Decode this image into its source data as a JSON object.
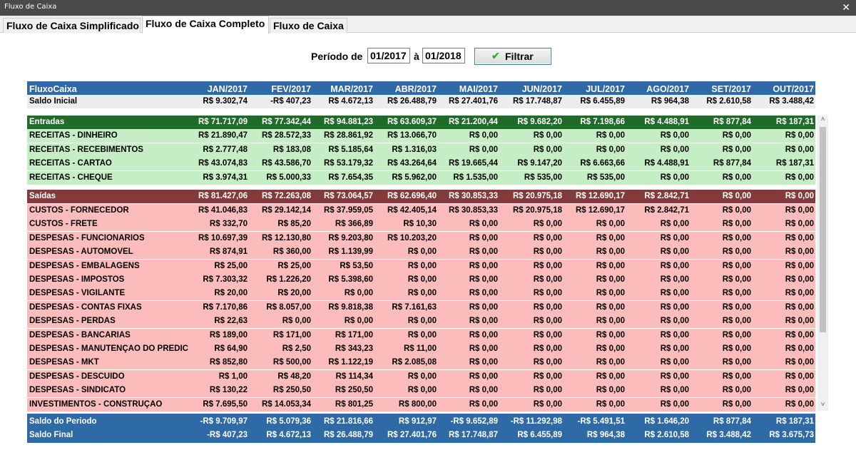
{
  "window": {
    "title": "Fluxo de Caixa",
    "close_glyph": "✕"
  },
  "tabs": [
    {
      "label": "Fluxo de Caixa Simplificado"
    },
    {
      "label": "Fluxo de Caixa Completo"
    },
    {
      "label": "Fluxo de Caixa"
    }
  ],
  "filter": {
    "periodo_label": "Período de",
    "date_from": "01/2017",
    "between_label": "à",
    "date_to": "01/2018",
    "button_label": "Filtrar",
    "button_icon": "check-icon"
  },
  "grid": {
    "header": [
      "FluxoCaixa",
      "JAN/2017",
      "FEV/2017",
      "MAR/2017",
      "ABR/2017",
      "MAI/2017",
      "JUN/2017",
      "JUL/2017",
      "AGO/2017",
      "SET/2017",
      "OUT/2017"
    ],
    "saldo_inicial": [
      "Saldo Inicial",
      "R$ 9.302,74",
      "-R$ 407,23",
      "R$ 4.672,13",
      "R$ 26.488,79",
      "R$ 27.401,76",
      "R$ 17.748,87",
      "R$ 6.455,89",
      "R$ 964,38",
      "R$ 2.610,58",
      "R$ 3.488,42"
    ],
    "entradas": [
      "Entradas",
      "R$ 71.717,09",
      "R$ 77.342,44",
      "R$ 94.881,23",
      "R$ 63.609,37",
      "R$ 21.200,44",
      "R$ 9.682,20",
      "R$ 7.198,66",
      "R$ 4.488,91",
      "R$ 877,84",
      "R$ 187,31"
    ],
    "entradas_rows": [
      [
        "RECEITAS - DINHEIRO",
        "R$ 21.890,47",
        "R$ 28.572,33",
        "R$ 28.861,92",
        "R$ 13.066,70",
        "R$ 0,00",
        "R$ 0,00",
        "R$ 0,00",
        "R$ 0,00",
        "R$ 0,00",
        "R$ 0,00"
      ],
      [
        "RECEITAS - RECEBIMENTOS",
        "R$ 2.777,48",
        "R$ 183,08",
        "R$ 5.185,64",
        "R$ 1.316,03",
        "R$ 0,00",
        "R$ 0,00",
        "R$ 0,00",
        "R$ 0,00",
        "R$ 0,00",
        "R$ 0,00"
      ],
      [
        "RECEITAS - CARTAO",
        "R$ 43.074,83",
        "R$ 43.586,70",
        "R$ 53.179,32",
        "R$ 43.264,64",
        "R$ 19.665,44",
        "R$ 9.147,20",
        "R$ 6.663,66",
        "R$ 4.488,91",
        "R$ 877,84",
        "R$ 187,31"
      ],
      [
        "RECEITAS - CHEQUE",
        "R$ 3.974,31",
        "R$ 5.000,33",
        "R$ 7.654,35",
        "R$ 5.962,00",
        "R$ 1.535,00",
        "R$ 535,00",
        "R$ 535,00",
        "R$ 0,00",
        "R$ 0,00",
        "R$ 0,00"
      ]
    ],
    "saidas": [
      "Saídas",
      "R$ 81.427,06",
      "R$ 72.263,08",
      "R$ 73.064,57",
      "R$ 62.696,40",
      "R$ 30.853,33",
      "R$ 20.975,18",
      "R$ 12.690,17",
      "R$ 2.842,71",
      "R$ 0,00",
      "R$ 0,00"
    ],
    "saidas_rows": [
      [
        "CUSTOS - FORNECEDOR",
        "R$ 41.046,83",
        "R$ 29.142,14",
        "R$ 37.959,05",
        "R$ 42.405,14",
        "R$ 30.853,33",
        "R$ 20.975,18",
        "R$ 12.690,17",
        "R$ 2.842,71",
        "R$ 0,00",
        "R$ 0,00"
      ],
      [
        "CUSTOS - FRETE",
        "R$ 332,70",
        "R$ 85,20",
        "R$ 366,89",
        "R$ 10,30",
        "R$ 0,00",
        "R$ 0,00",
        "R$ 0,00",
        "R$ 0,00",
        "R$ 0,00",
        "R$ 0,00"
      ],
      [
        "DESPESAS - FUNCIONARIOS",
        "R$ 10.697,39",
        "R$ 12.130,80",
        "R$ 9.203,80",
        "R$ 10.203,20",
        "R$ 0,00",
        "R$ 0,00",
        "R$ 0,00",
        "R$ 0,00",
        "R$ 0,00",
        "R$ 0,00"
      ],
      [
        "DESPESAS - AUTOMÓVEL",
        "R$ 874,91",
        "R$ 360,00",
        "R$ 1.139,99",
        "R$ 0,00",
        "R$ 0,00",
        "R$ 0,00",
        "R$ 0,00",
        "R$ 0,00",
        "R$ 0,00",
        "R$ 0,00"
      ],
      [
        "DESPESAS - EMBALAGENS",
        "R$ 25,00",
        "R$ 25,00",
        "R$ 53,50",
        "R$ 0,00",
        "R$ 0,00",
        "R$ 0,00",
        "R$ 0,00",
        "R$ 0,00",
        "R$ 0,00",
        "R$ 0,00"
      ],
      [
        "DESPESAS - IMPOSTOS",
        "R$ 7.303,32",
        "R$ 1.226,20",
        "R$ 5.398,60",
        "R$ 0,00",
        "R$ 0,00",
        "R$ 0,00",
        "R$ 0,00",
        "R$ 0,00",
        "R$ 0,00",
        "R$ 0,00"
      ],
      [
        "DESPESAS - VIGILANTE",
        "R$ 20,00",
        "R$ 20,00",
        "R$ 0,00",
        "R$ 0,00",
        "R$ 0,00",
        "R$ 0,00",
        "R$ 0,00",
        "R$ 0,00",
        "R$ 0,00",
        "R$ 0,00"
      ],
      [
        "DESPESAS - CONTAS FIXAS",
        "R$ 7.170,86",
        "R$ 8.057,00",
        "R$ 9.818,38",
        "R$ 7.161,63",
        "R$ 0,00",
        "R$ 0,00",
        "R$ 0,00",
        "R$ 0,00",
        "R$ 0,00",
        "R$ 0,00"
      ],
      [
        "DESPESAS - PERDAS",
        "R$ 22,63",
        "R$ 0,00",
        "R$ 0,00",
        "R$ 0,00",
        "R$ 0,00",
        "R$ 0,00",
        "R$ 0,00",
        "R$ 0,00",
        "R$ 0,00",
        "R$ 0,00"
      ],
      [
        "DESPESAS - BANCARIAS",
        "R$ 189,00",
        "R$ 171,00",
        "R$ 171,00",
        "R$ 0,00",
        "R$ 0,00",
        "R$ 0,00",
        "R$ 0,00",
        "R$ 0,00",
        "R$ 0,00",
        "R$ 0,00"
      ],
      [
        "DESPESAS - MANUTENÇÃO DO PRÉDIC",
        "R$ 64,90",
        "R$ 2,50",
        "R$ 343,23",
        "R$ 11,00",
        "R$ 0,00",
        "R$ 0,00",
        "R$ 0,00",
        "R$ 0,00",
        "R$ 0,00",
        "R$ 0,00"
      ],
      [
        "DESPESAS - MKT",
        "R$ 852,80",
        "R$ 500,00",
        "R$ 1.122,19",
        "R$ 2.085,08",
        "R$ 0,00",
        "R$ 0,00",
        "R$ 0,00",
        "R$ 0,00",
        "R$ 0,00",
        "R$ 0,00"
      ],
      [
        "DESPESAS - DESCUIDO",
        "R$ 1,00",
        "R$ 48,20",
        "R$ 114,34",
        "R$ 0,00",
        "R$ 0,00",
        "R$ 0,00",
        "R$ 0,00",
        "R$ 0,00",
        "R$ 0,00",
        "R$ 0,00"
      ],
      [
        "DESPESAS - SINDICATO",
        "R$ 130,22",
        "R$ 250,50",
        "R$ 250,50",
        "R$ 0,00",
        "R$ 0,00",
        "R$ 0,00",
        "R$ 0,00",
        "R$ 0,00",
        "R$ 0,00",
        "R$ 0,00"
      ],
      [
        "INVESTIMENTOS - CONSTRUÇÃO",
        "R$ 7.695,50",
        "R$ 14.053,34",
        "R$ 801,25",
        "R$ 800,00",
        "R$ 0,00",
        "R$ 0,00",
        "R$ 0,00",
        "R$ 0,00",
        "R$ 0,00",
        "R$ 0,00"
      ]
    ],
    "saldo_periodo": [
      "Saldo do Periodo",
      "-R$ 9.709,97",
      "R$ 5.079,36",
      "R$ 21.816,66",
      "R$ 912,97",
      "-R$ 9.652,89",
      "-R$ 11.292,98",
      "-R$ 5.491,51",
      "R$ 1.646,20",
      "R$ 877,84",
      "R$ 187,31"
    ],
    "saldo_final": [
      "Saldo Final",
      "-R$ 407,23",
      "R$ 4.672,13",
      "R$ 26.488,79",
      "R$ 27.401,76",
      "R$ 17.748,87",
      "R$ 6.455,89",
      "R$ 964,38",
      "R$ 2.610,58",
      "R$ 3.488,42",
      "R$ 3.675,73"
    ]
  },
  "scrollbar": {
    "up_glyph": "˄",
    "down_glyph": "˅",
    "position": 0.0
  },
  "colors": {
    "header_blue": "#2e6aa6",
    "entradas_green": "#1f6b28",
    "entradas_row": "#c6eec5",
    "saidas_red": "#843a3a",
    "saidas_row": "#fcbcbc"
  }
}
